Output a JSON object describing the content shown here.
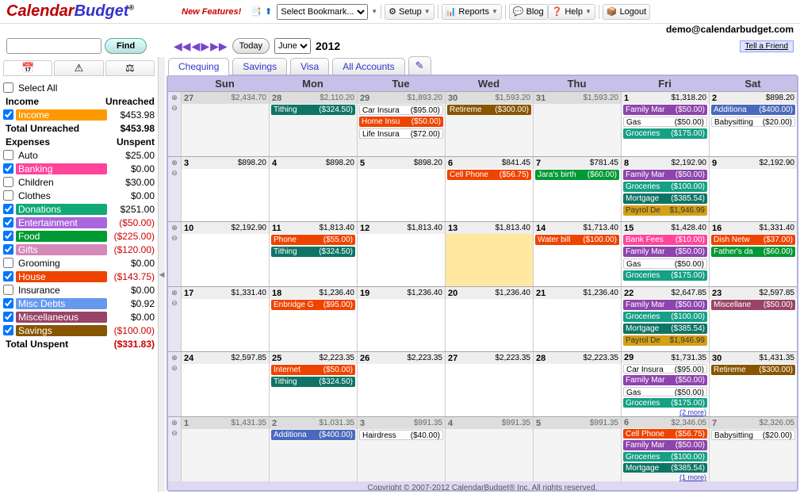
{
  "app": {
    "logo1": "Calendar",
    "logo2": "Budget",
    "reg": "®",
    "newfeat": "New Features!"
  },
  "header": {
    "bookmark_placeholder": "Select Bookmark...",
    "setup": "Setup",
    "reports": "Reports",
    "blog": "Blog",
    "help": "Help",
    "logout": "Logout",
    "email": "demo@calendarbudget.com"
  },
  "nav": {
    "find": "Find",
    "today": "Today",
    "month": "June",
    "year": "2012",
    "tell": "Tell a Friend"
  },
  "accounts": [
    "Chequing",
    "Savings",
    "Visa",
    "All Accounts"
  ],
  "weekdays": [
    "Sun",
    "Mon",
    "Tue",
    "Wed",
    "Thu",
    "Fri",
    "Sat"
  ],
  "sidebar": {
    "selectall": "Select All",
    "h_income": "Income",
    "h_unreached": "Unreached",
    "h_total_unreached": "Total Unreached",
    "v_total_unreached": "$453.98",
    "h_expenses": "Expenses",
    "h_unspent": "Unspent",
    "h_total_unspent": "Total Unspent",
    "v_total_unspent": "($331.83)",
    "cats": [
      {
        "name": "Income",
        "val": "$453.98",
        "checked": true,
        "color": "c-income",
        "neg": false
      },
      {
        "name": "Auto",
        "val": "$25.00",
        "checked": false,
        "color": "",
        "neg": false
      },
      {
        "name": "Banking",
        "val": "$0.00",
        "checked": true,
        "color": "c-banking",
        "neg": false
      },
      {
        "name": "Children",
        "val": "$30.00",
        "checked": false,
        "color": "",
        "neg": false
      },
      {
        "name": "Clothes",
        "val": "$0.00",
        "checked": false,
        "color": "",
        "neg": false
      },
      {
        "name": "Donations",
        "val": "$251.00",
        "checked": true,
        "color": "c-donations",
        "neg": false
      },
      {
        "name": "Entertainment",
        "val": "($50.00)",
        "checked": true,
        "color": "c-entertainment",
        "neg": true
      },
      {
        "name": "Food",
        "val": "($225.00)",
        "checked": true,
        "color": "c-food",
        "neg": true
      },
      {
        "name": "Gifts",
        "val": "($120.00)",
        "checked": true,
        "color": "c-gifts",
        "neg": true
      },
      {
        "name": "Grooming",
        "val": "$0.00",
        "checked": false,
        "color": "",
        "neg": false
      },
      {
        "name": "House",
        "val": "($143.75)",
        "checked": true,
        "color": "c-house",
        "neg": true
      },
      {
        "name": "Insurance",
        "val": "$0.00",
        "checked": false,
        "color": "",
        "neg": false
      },
      {
        "name": "Misc Debts",
        "val": "$0.92",
        "checked": true,
        "color": "c-miscdebts",
        "neg": false
      },
      {
        "name": "Miscellaneous",
        "val": "$0.00",
        "checked": true,
        "color": "c-miscellaneous",
        "neg": false
      },
      {
        "name": "Savings",
        "val": "($100.00)",
        "checked": true,
        "color": "c-savings",
        "neg": true
      }
    ]
  },
  "weeks": [
    {
      "days": [
        {
          "n": "27",
          "bal": "$2,434.70",
          "othm": true,
          "events": []
        },
        {
          "n": "28",
          "bal": "$2,110.20",
          "othm": true,
          "events": [
            {
              "t": "Tithing",
              "a": "($324.50)",
              "c": "c-darkteal"
            }
          ]
        },
        {
          "n": "29",
          "bal": "$1,893.20",
          "othm": true,
          "events": [
            {
              "t": "Car Insura",
              "a": "($95.00)",
              "c": "plain"
            },
            {
              "t": "Home Insu",
              "a": "($50.00)",
              "c": "c-house"
            },
            {
              "t": "Life Insura",
              "a": "($72.00)",
              "c": "plain"
            }
          ]
        },
        {
          "n": "30",
          "bal": "$1,593.20",
          "othm": true,
          "events": [
            {
              "t": "Retireme",
              "a": "($300.00)",
              "c": "c-savings"
            }
          ]
        },
        {
          "n": "31",
          "bal": "$1,593.20",
          "othm": true,
          "events": []
        },
        {
          "n": "1",
          "bal": "$1,318.20",
          "events": [
            {
              "t": "Family Mar",
              "a": "($50.00)",
              "c": "c-purple"
            },
            {
              "t": "Gas",
              "a": "($50.00)",
              "c": "plain"
            },
            {
              "t": "Groceries",
              "a": "($175.00)",
              "c": "c-teal"
            }
          ]
        },
        {
          "n": "2",
          "bal": "$898.20",
          "events": [
            {
              "t": "Additiona",
              "a": "($400.00)",
              "c": "c-blue"
            },
            {
              "t": "Babysitting",
              "a": "($20.00)",
              "c": "plain"
            }
          ]
        }
      ]
    },
    {
      "days": [
        {
          "n": "3",
          "bal": "$898.20",
          "events": []
        },
        {
          "n": "4",
          "bal": "$898.20",
          "events": []
        },
        {
          "n": "5",
          "bal": "$898.20",
          "events": []
        },
        {
          "n": "6",
          "bal": "$841.45",
          "events": [
            {
              "t": "Cell Phone",
              "a": "($56.75)",
              "c": "c-house"
            }
          ]
        },
        {
          "n": "7",
          "bal": "$781.45",
          "events": [
            {
              "t": "Jara's birth",
              "a": "($60.00)",
              "c": "c-food"
            }
          ]
        },
        {
          "n": "8",
          "bal": "$2,192.90",
          "events": [
            {
              "t": "Family Mar",
              "a": "($50.00)",
              "c": "c-purple"
            },
            {
              "t": "Groceries",
              "a": "($100.00)",
              "c": "c-teal"
            },
            {
              "t": "Mortgage",
              "a": "($385.54)",
              "c": "c-darkteal"
            },
            {
              "t": "Payrol De",
              "a": "$1,946.99",
              "c": "c-gold"
            }
          ]
        },
        {
          "n": "9",
          "bal": "$2,192.90",
          "events": []
        }
      ]
    },
    {
      "days": [
        {
          "n": "10",
          "bal": "$2,192.90",
          "events": []
        },
        {
          "n": "11",
          "bal": "$1,813.40",
          "events": [
            {
              "t": "Phone",
              "a": "($55.00)",
              "c": "c-house"
            },
            {
              "t": "Tithing",
              "a": "($324.50)",
              "c": "c-darkteal"
            }
          ]
        },
        {
          "n": "12",
          "bal": "$1,813.40",
          "events": []
        },
        {
          "n": "13",
          "bal": "$1,813.40",
          "today": true,
          "events": []
        },
        {
          "n": "14",
          "bal": "$1,713.40",
          "events": [
            {
              "t": "Water bill",
              "a": "($100.00)",
              "c": "c-house"
            }
          ]
        },
        {
          "n": "15",
          "bal": "$1,428.40",
          "events": [
            {
              "t": "Bank Fees",
              "a": "($10.00)",
              "c": "c-banking"
            },
            {
              "t": "Family Mar",
              "a": "($50.00)",
              "c": "c-purple"
            },
            {
              "t": "Gas",
              "a": "($50.00)",
              "c": "plain"
            },
            {
              "t": "Groceries",
              "a": "($175.00)",
              "c": "c-teal"
            }
          ]
        },
        {
          "n": "16",
          "bal": "$1,331.40",
          "events": [
            {
              "t": "Dish Netw",
              "a": "($37.00)",
              "c": "c-house"
            },
            {
              "t": "Father's da",
              "a": "($60.00)",
              "c": "c-food"
            }
          ]
        }
      ]
    },
    {
      "days": [
        {
          "n": "17",
          "bal": "$1,331.40",
          "events": []
        },
        {
          "n": "18",
          "bal": "$1,236.40",
          "events": [
            {
              "t": "Enbridge G",
              "a": "($95.00)",
              "c": "c-house"
            }
          ]
        },
        {
          "n": "19",
          "bal": "$1,236.40",
          "events": []
        },
        {
          "n": "20",
          "bal": "$1,236.40",
          "events": []
        },
        {
          "n": "21",
          "bal": "$1,236.40",
          "events": []
        },
        {
          "n": "22",
          "bal": "$2,647.85",
          "events": [
            {
              "t": "Family Mar",
              "a": "($50.00)",
              "c": "c-purple"
            },
            {
              "t": "Groceries",
              "a": "($100.00)",
              "c": "c-teal"
            },
            {
              "t": "Mortgage",
              "a": "($385.54)",
              "c": "c-darkteal"
            },
            {
              "t": "Payrol De",
              "a": "$1,946.99",
              "c": "c-gold"
            }
          ]
        },
        {
          "n": "23",
          "bal": "$2,597.85",
          "events": [
            {
              "t": "Miscellane",
              "a": "($50.00)",
              "c": "c-miscellaneous"
            }
          ]
        }
      ]
    },
    {
      "days": [
        {
          "n": "24",
          "bal": "$2,597.85",
          "events": []
        },
        {
          "n": "25",
          "bal": "$2,223.35",
          "events": [
            {
              "t": "Internet",
              "a": "($50.00)",
              "c": "c-house"
            },
            {
              "t": "Tithing",
              "a": "($324.50)",
              "c": "c-darkteal"
            }
          ]
        },
        {
          "n": "26",
          "bal": "$2,223.35",
          "events": []
        },
        {
          "n": "27",
          "bal": "$2,223.35",
          "events": []
        },
        {
          "n": "28",
          "bal": "$2,223.35",
          "events": []
        },
        {
          "n": "29",
          "bal": "$1,731.35",
          "more": "(2 more)",
          "events": [
            {
              "t": "Car Insura",
              "a": "($95.00)",
              "c": "plain"
            },
            {
              "t": "Family Mar",
              "a": "($50.00)",
              "c": "c-purple"
            },
            {
              "t": "Gas",
              "a": "($50.00)",
              "c": "plain"
            },
            {
              "t": "Groceries",
              "a": "($175.00)",
              "c": "c-teal"
            }
          ]
        },
        {
          "n": "30",
          "bal": "$1,431.35",
          "events": [
            {
              "t": "Retireme",
              "a": "($300.00)",
              "c": "c-savings"
            }
          ]
        }
      ]
    },
    {
      "days": [
        {
          "n": "1",
          "bal": "$1,431.35",
          "othm": true,
          "events": []
        },
        {
          "n": "2",
          "bal": "$1,031.35",
          "othm": true,
          "events": [
            {
              "t": "Additiona",
              "a": "($400.00)",
              "c": "c-blue"
            }
          ]
        },
        {
          "n": "3",
          "bal": "$991.35",
          "othm": true,
          "events": [
            {
              "t": "Hairdress",
              "a": "($40.00)",
              "c": "plain"
            }
          ]
        },
        {
          "n": "4",
          "bal": "$991.35",
          "othm": true,
          "events": []
        },
        {
          "n": "5",
          "bal": "$991.35",
          "othm": true,
          "events": []
        },
        {
          "n": "6",
          "bal": "$2,346.05",
          "othm": true,
          "more": "(1 more)",
          "events": [
            {
              "t": "Cell Phone",
              "a": "($56.75)",
              "c": "c-house"
            },
            {
              "t": "Family Mar",
              "a": "($50.00)",
              "c": "c-purple"
            },
            {
              "t": "Groceries",
              "a": "($100.00)",
              "c": "c-teal"
            },
            {
              "t": "Mortgage",
              "a": "($385.54)",
              "c": "c-darkteal"
            }
          ]
        },
        {
          "n": "7",
          "bal": "$2,326.05",
          "othm": true,
          "events": [
            {
              "t": "Babysitting",
              "a": "($20.00)",
              "c": "plain"
            }
          ]
        }
      ]
    }
  ],
  "footer": "Copyright © 2007-2012 CalendarBudget® Inc. All rights reserved."
}
